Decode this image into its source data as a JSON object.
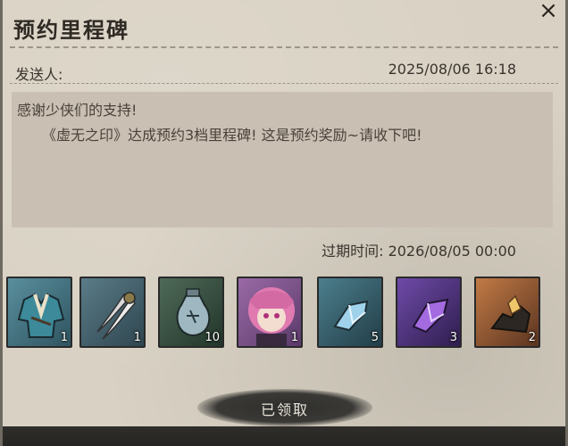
{
  "mail": {
    "title": "预约里程碑",
    "close_icon": "×",
    "sender_label": "发送人:",
    "sent_time": "2025/08/06 16:18",
    "body_line1": "感谢少侠们的支持!",
    "body_line2": "《虚无之印》达成预约3档里程碑! 这是预约奖励~请收下吧!",
    "expire_label": "过期时间:",
    "expire_time": "2026/08/05 00:00",
    "expire_full": "过期时间: 2026/08/05 00:00",
    "claim_label": "已领取"
  },
  "rewards": [
    {
      "icon": "robe-icon",
      "qty": "1",
      "bg": "#3c6a78"
    },
    {
      "icon": "claw-blade-icon",
      "qty": "1",
      "bg": "#3a5866"
    },
    {
      "icon": "potion-pouch-icon",
      "qty": "10",
      "bg": "#2f4a3c"
    },
    {
      "icon": "character-portrait-icon",
      "qty": "1",
      "bg": "#7a5a80"
    },
    {
      "icon": "blue-crystal-icon",
      "qty": "5",
      "bg": "#2f5866"
    },
    {
      "icon": "purple-crystal-icon",
      "qty": "3",
      "bg": "#4a2f78"
    },
    {
      "icon": "gold-ore-icon",
      "qty": "2",
      "bg": "#8a5a38"
    }
  ]
}
